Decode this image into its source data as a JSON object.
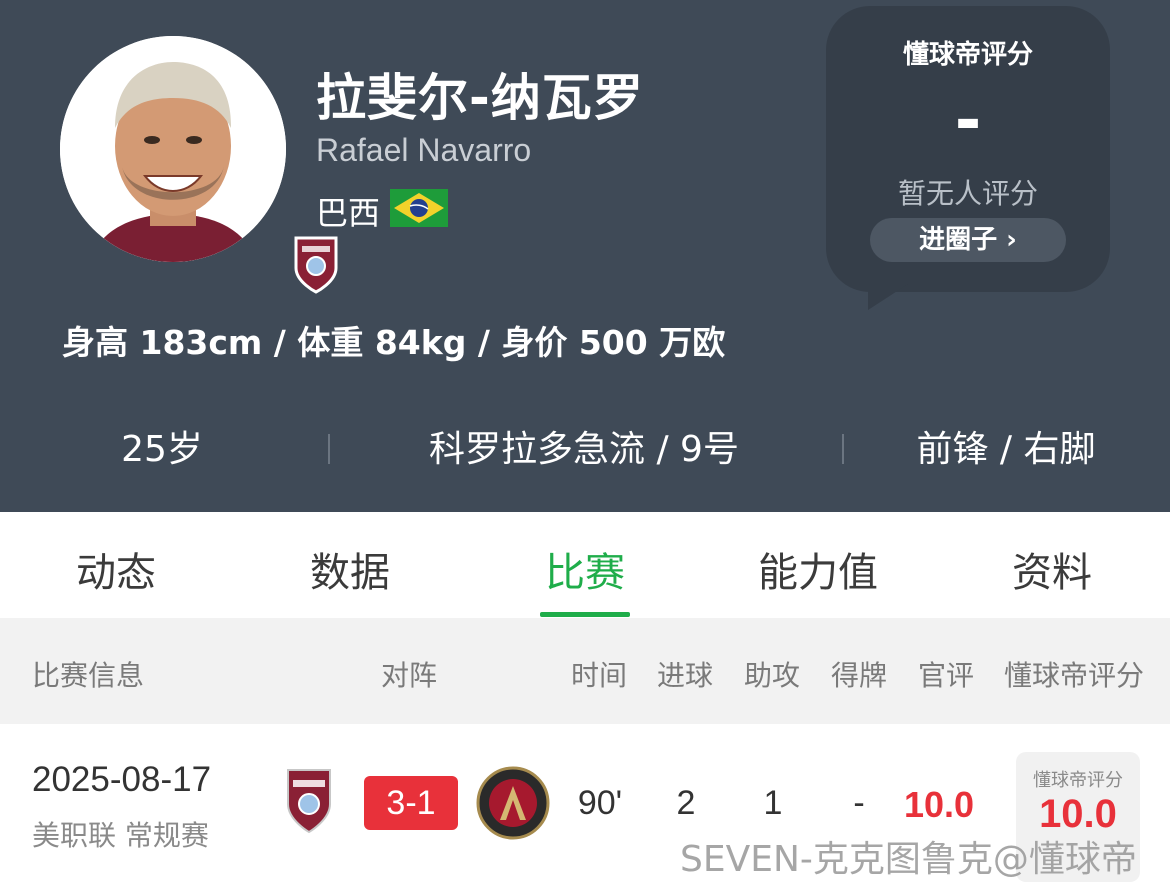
{
  "player": {
    "name_cn": "拉斐尔-纳瓦罗",
    "name_en": "Rafael Navarro",
    "nationality": "巴西",
    "bio_line": "身高 183cm / 体重 84kg / 身价 500 万欧",
    "age": "25岁",
    "club_number": "科罗拉多急流 / 9号",
    "position_foot": "前锋 / 右脚"
  },
  "rating_card": {
    "title": "懂球帝评分",
    "value": "-",
    "note": "暂无人评分",
    "join_label": "进圈子 ›"
  },
  "tabs": [
    {
      "label": "动态",
      "active": false
    },
    {
      "label": "数据",
      "active": false
    },
    {
      "label": "比赛",
      "active": true
    },
    {
      "label": "能力值",
      "active": false
    },
    {
      "label": "资料",
      "active": false
    }
  ],
  "table": {
    "headers": {
      "match_info": "比赛信息",
      "lineup": "对阵",
      "time": "时间",
      "goals": "进球",
      "assists": "助攻",
      "cards": "得牌",
      "official": "官评",
      "dqd_rating": "懂球帝评分"
    },
    "rows": [
      {
        "date": "2025-08-17",
        "league": "美职联 常规赛",
        "score": "3-1",
        "time": "90'",
        "goals": "2",
        "assists": "1",
        "cards": "-",
        "official": "10.0",
        "dqd_label": "懂球帝评分",
        "dqd_score": "10.0"
      }
    ]
  },
  "watermark": "SEVEN-克克图鲁克@懂球帝",
  "colors": {
    "header_bg": "#3f4a57",
    "accent_green": "#1fad4a",
    "score_red": "#e8313a"
  },
  "icons": {
    "club_badge": "colorado-rapids-badge",
    "flag": "brazil-flag",
    "away_logo": "atlanta-united-logo"
  }
}
